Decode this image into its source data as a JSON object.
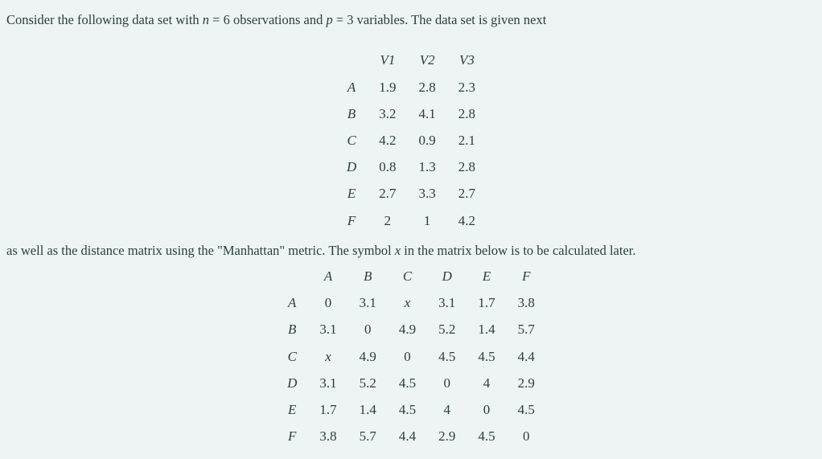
{
  "intro": {
    "prefix": "Consider the following data set with ",
    "n_var": "n",
    "eq1": " = ",
    "n_val": "6",
    "obs_text": " observations and ",
    "p_var": "p",
    "eq2": " = ",
    "p_val": "3",
    "suffix": " variables. The data set is given next"
  },
  "data_table": {
    "headers": [
      "V1",
      "V2",
      "V3"
    ],
    "rows": [
      {
        "label": "A",
        "values": [
          "1.9",
          "2.8",
          "2.3"
        ]
      },
      {
        "label": "B",
        "values": [
          "3.2",
          "4.1",
          "2.8"
        ]
      },
      {
        "label": "C",
        "values": [
          "4.2",
          "0.9",
          "2.1"
        ]
      },
      {
        "label": "D",
        "values": [
          "0.8",
          "1.3",
          "2.8"
        ]
      },
      {
        "label": "E",
        "values": [
          "2.7",
          "3.3",
          "2.7"
        ]
      },
      {
        "label": "F",
        "values": [
          "2",
          "1",
          "4.2"
        ]
      }
    ]
  },
  "middle": {
    "prefix": "as well as the distance matrix using the \"Manhattan\" metric. The symbol ",
    "x_var": "x",
    "suffix": " in the matrix below is to be calculated later."
  },
  "distance_table": {
    "headers": [
      "A",
      "B",
      "C",
      "D",
      "E",
      "F"
    ],
    "rows": [
      {
        "label": "A",
        "values": [
          "0",
          "3.1",
          "x",
          "3.1",
          "1.7",
          "3.8"
        ]
      },
      {
        "label": "B",
        "values": [
          "3.1",
          "0",
          "4.9",
          "5.2",
          "1.4",
          "5.7"
        ]
      },
      {
        "label": "C",
        "values": [
          "x",
          "4.9",
          "0",
          "4.5",
          "4.5",
          "4.4"
        ]
      },
      {
        "label": "D",
        "values": [
          "3.1",
          "5.2",
          "4.5",
          "0",
          "4",
          "2.9"
        ]
      },
      {
        "label": "E",
        "values": [
          "1.7",
          "1.4",
          "4.5",
          "4",
          "0",
          "4.5"
        ]
      },
      {
        "label": "F",
        "values": [
          "3.8",
          "5.7",
          "4.4",
          "2.9",
          "4.5",
          "0"
        ]
      }
    ]
  }
}
